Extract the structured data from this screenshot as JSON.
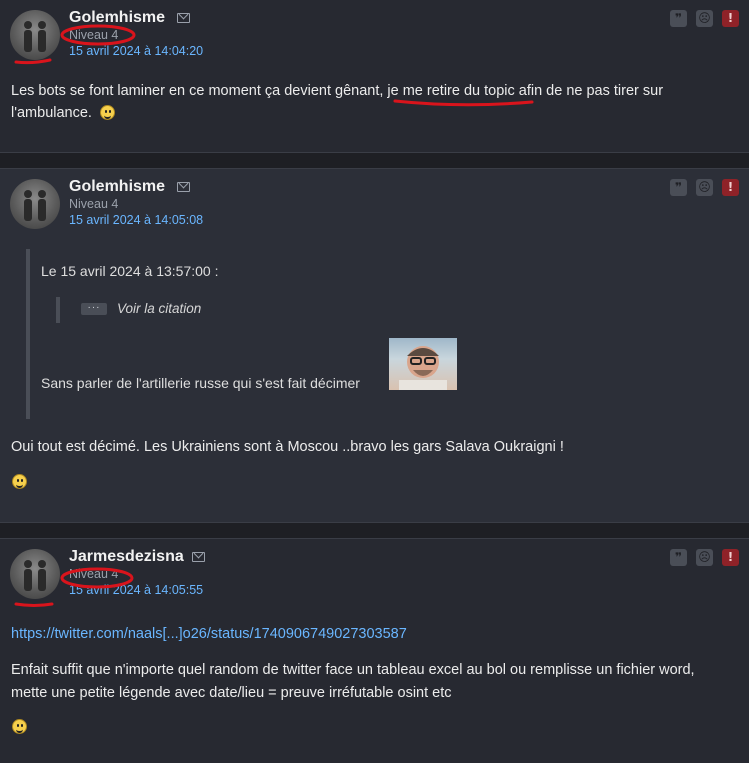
{
  "posts": [
    {
      "author": "Golemhisme",
      "level": "Niveau 4",
      "date": "15 avril 2024 à 14:04:20",
      "body": "Les bots se font laminer en ce moment ça devient gênant, je me retire du topic afin de ne pas tirer sur",
      "body_line2": "l'ambulance."
    },
    {
      "author": "Golemhisme",
      "level": "Niveau 4",
      "date": "15 avril 2024 à 14:05:08",
      "quote": {
        "header": "Le 15 avril 2024 à 13:57:00 :",
        "show_citation": "Voir la citation",
        "ellipsis": "···",
        "text": "Sans parler de l'artillerie russe qui s'est fait décimer"
      },
      "body": "Oui tout est décimé. Les Ukrainiens sont à Moscou ..bravo les gars Salava Oukraigni !"
    },
    {
      "author": "Jarmesdezisna",
      "level": "Niveau 4",
      "date": "15 avril 2024 à 14:05:55",
      "link": "https://twitter.com/naals[...]o26/status/1740906749027303587",
      "body": "Enfait suffit que n'importe quel random de twitter face un tableau excel au bol ou remplisse un fichier word,",
      "body_line2": "mette une petite légende avec date/lieu = preuve irréfutable osint etc"
    }
  ],
  "actions": {
    "quote": "❞",
    "sad": "☹",
    "alert": "!"
  },
  "icons": [
    "avatar",
    "mail-icon",
    "quote-icon",
    "sad-icon",
    "alert-icon",
    "smiley-icon"
  ],
  "colors": {
    "background": "#1e1f24",
    "post": "#272931",
    "link": "#6ab6ff",
    "alert": "#8f2228",
    "annotation": "#d9141c"
  }
}
